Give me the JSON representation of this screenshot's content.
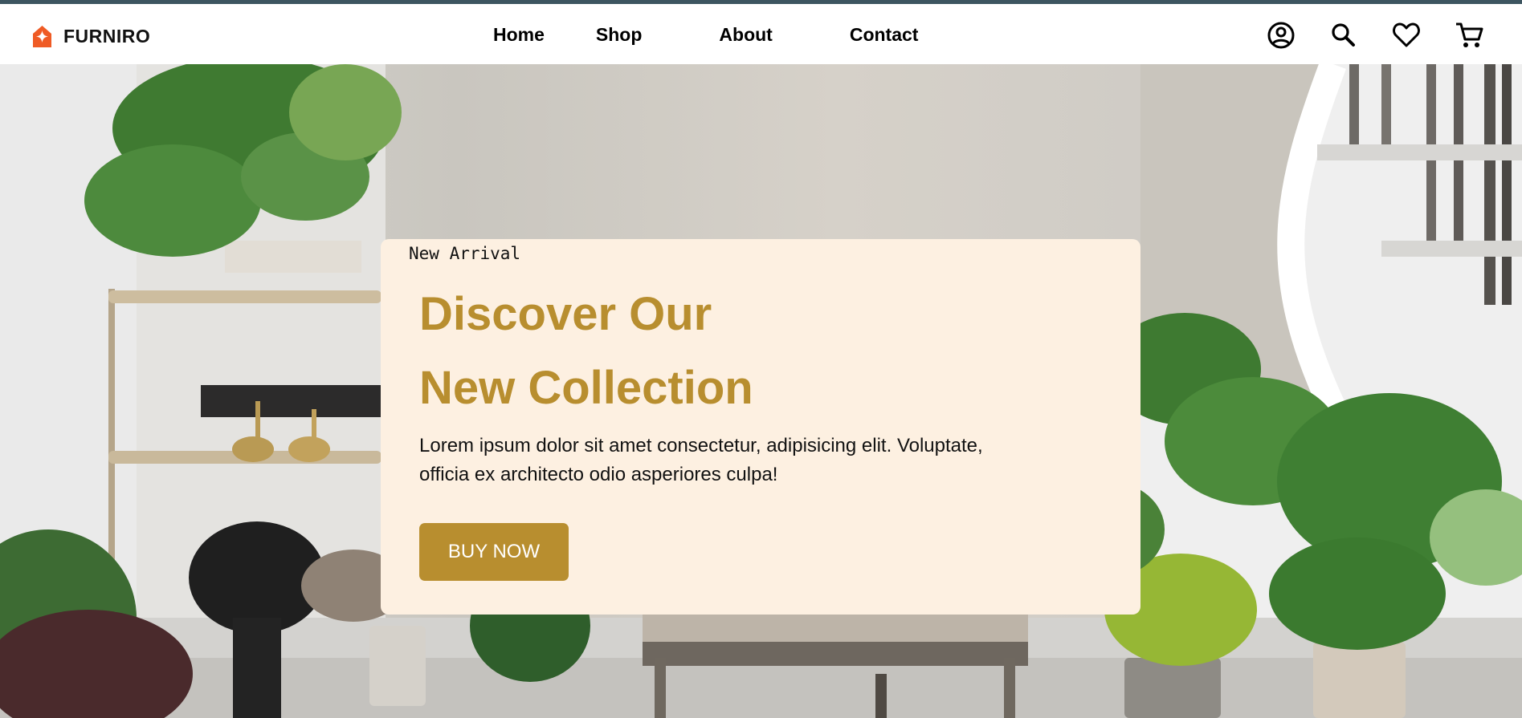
{
  "brand": {
    "name": "FURNIRO",
    "logo_icon": "furniro-logo-icon",
    "logo_color": "#ef5b25"
  },
  "nav": {
    "links": [
      {
        "label": "Home"
      },
      {
        "label": "Shop"
      },
      {
        "label": "About"
      },
      {
        "label": "Contact"
      }
    ],
    "icons": [
      "account-icon",
      "search-icon",
      "heart-icon",
      "cart-icon"
    ]
  },
  "hero": {
    "background": "indoor plants and furniture photo",
    "card": {
      "eyebrow": "New Arrival",
      "headline_line1": "Discover Our",
      "headline_line2": "New Collection",
      "description": "Lorem ipsum dolor sit amet consectetur, adipisicing elit. Voluptate, officia ex architecto odio asperiores culpa!",
      "button_label": "BUY NOW",
      "accent_color": "#b88e2f",
      "card_color": "#fdf0e1"
    }
  }
}
